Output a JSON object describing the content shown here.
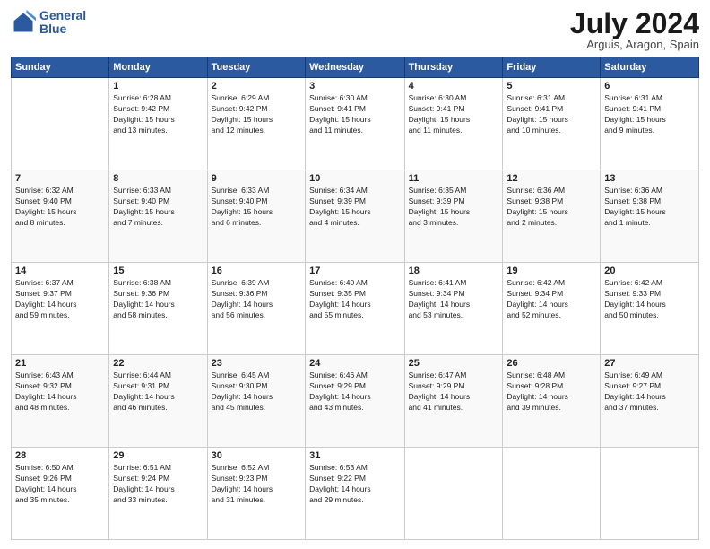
{
  "header": {
    "logo_line1": "General",
    "logo_line2": "Blue",
    "month": "July 2024",
    "location": "Arguis, Aragon, Spain"
  },
  "days_of_week": [
    "Sunday",
    "Monday",
    "Tuesday",
    "Wednesday",
    "Thursday",
    "Friday",
    "Saturday"
  ],
  "weeks": [
    [
      {
        "day": "",
        "content": ""
      },
      {
        "day": "1",
        "content": "Sunrise: 6:28 AM\nSunset: 9:42 PM\nDaylight: 15 hours\nand 13 minutes."
      },
      {
        "day": "2",
        "content": "Sunrise: 6:29 AM\nSunset: 9:42 PM\nDaylight: 15 hours\nand 12 minutes."
      },
      {
        "day": "3",
        "content": "Sunrise: 6:30 AM\nSunset: 9:41 PM\nDaylight: 15 hours\nand 11 minutes."
      },
      {
        "day": "4",
        "content": "Sunrise: 6:30 AM\nSunset: 9:41 PM\nDaylight: 15 hours\nand 11 minutes."
      },
      {
        "day": "5",
        "content": "Sunrise: 6:31 AM\nSunset: 9:41 PM\nDaylight: 15 hours\nand 10 minutes."
      },
      {
        "day": "6",
        "content": "Sunrise: 6:31 AM\nSunset: 9:41 PM\nDaylight: 15 hours\nand 9 minutes."
      }
    ],
    [
      {
        "day": "7",
        "content": "Sunrise: 6:32 AM\nSunset: 9:40 PM\nDaylight: 15 hours\nand 8 minutes."
      },
      {
        "day": "8",
        "content": "Sunrise: 6:33 AM\nSunset: 9:40 PM\nDaylight: 15 hours\nand 7 minutes."
      },
      {
        "day": "9",
        "content": "Sunrise: 6:33 AM\nSunset: 9:40 PM\nDaylight: 15 hours\nand 6 minutes."
      },
      {
        "day": "10",
        "content": "Sunrise: 6:34 AM\nSunset: 9:39 PM\nDaylight: 15 hours\nand 4 minutes."
      },
      {
        "day": "11",
        "content": "Sunrise: 6:35 AM\nSunset: 9:39 PM\nDaylight: 15 hours\nand 3 minutes."
      },
      {
        "day": "12",
        "content": "Sunrise: 6:36 AM\nSunset: 9:38 PM\nDaylight: 15 hours\nand 2 minutes."
      },
      {
        "day": "13",
        "content": "Sunrise: 6:36 AM\nSunset: 9:38 PM\nDaylight: 15 hours\nand 1 minute."
      }
    ],
    [
      {
        "day": "14",
        "content": "Sunrise: 6:37 AM\nSunset: 9:37 PM\nDaylight: 14 hours\nand 59 minutes."
      },
      {
        "day": "15",
        "content": "Sunrise: 6:38 AM\nSunset: 9:36 PM\nDaylight: 14 hours\nand 58 minutes."
      },
      {
        "day": "16",
        "content": "Sunrise: 6:39 AM\nSunset: 9:36 PM\nDaylight: 14 hours\nand 56 minutes."
      },
      {
        "day": "17",
        "content": "Sunrise: 6:40 AM\nSunset: 9:35 PM\nDaylight: 14 hours\nand 55 minutes."
      },
      {
        "day": "18",
        "content": "Sunrise: 6:41 AM\nSunset: 9:34 PM\nDaylight: 14 hours\nand 53 minutes."
      },
      {
        "day": "19",
        "content": "Sunrise: 6:42 AM\nSunset: 9:34 PM\nDaylight: 14 hours\nand 52 minutes."
      },
      {
        "day": "20",
        "content": "Sunrise: 6:42 AM\nSunset: 9:33 PM\nDaylight: 14 hours\nand 50 minutes."
      }
    ],
    [
      {
        "day": "21",
        "content": "Sunrise: 6:43 AM\nSunset: 9:32 PM\nDaylight: 14 hours\nand 48 minutes."
      },
      {
        "day": "22",
        "content": "Sunrise: 6:44 AM\nSunset: 9:31 PM\nDaylight: 14 hours\nand 46 minutes."
      },
      {
        "day": "23",
        "content": "Sunrise: 6:45 AM\nSunset: 9:30 PM\nDaylight: 14 hours\nand 45 minutes."
      },
      {
        "day": "24",
        "content": "Sunrise: 6:46 AM\nSunset: 9:29 PM\nDaylight: 14 hours\nand 43 minutes."
      },
      {
        "day": "25",
        "content": "Sunrise: 6:47 AM\nSunset: 9:29 PM\nDaylight: 14 hours\nand 41 minutes."
      },
      {
        "day": "26",
        "content": "Sunrise: 6:48 AM\nSunset: 9:28 PM\nDaylight: 14 hours\nand 39 minutes."
      },
      {
        "day": "27",
        "content": "Sunrise: 6:49 AM\nSunset: 9:27 PM\nDaylight: 14 hours\nand 37 minutes."
      }
    ],
    [
      {
        "day": "28",
        "content": "Sunrise: 6:50 AM\nSunset: 9:26 PM\nDaylight: 14 hours\nand 35 minutes."
      },
      {
        "day": "29",
        "content": "Sunrise: 6:51 AM\nSunset: 9:24 PM\nDaylight: 14 hours\nand 33 minutes."
      },
      {
        "day": "30",
        "content": "Sunrise: 6:52 AM\nSunset: 9:23 PM\nDaylight: 14 hours\nand 31 minutes."
      },
      {
        "day": "31",
        "content": "Sunrise: 6:53 AM\nSunset: 9:22 PM\nDaylight: 14 hours\nand 29 minutes."
      },
      {
        "day": "",
        "content": ""
      },
      {
        "day": "",
        "content": ""
      },
      {
        "day": "",
        "content": ""
      }
    ]
  ]
}
